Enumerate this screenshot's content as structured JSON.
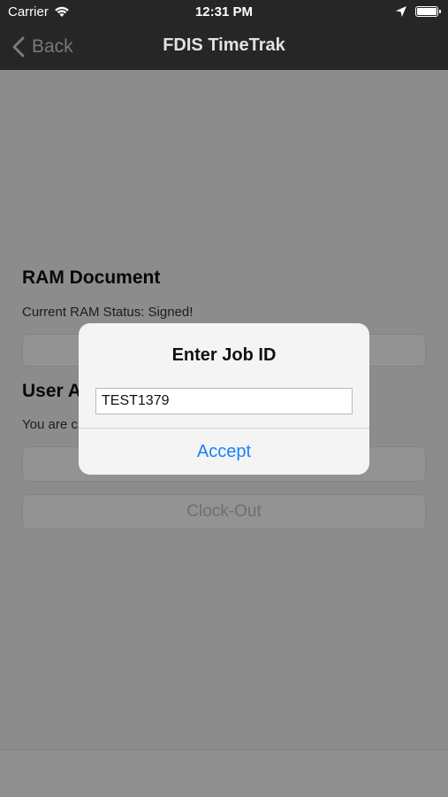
{
  "status_bar": {
    "carrier": "Carrier",
    "time": "12:31 PM"
  },
  "nav": {
    "back_label": "Back",
    "title": "FDIS TimeTrak"
  },
  "ram_section": {
    "heading": "RAM Document",
    "status_text": "Current RAM Status: Signed!"
  },
  "user_section": {
    "heading": "User A",
    "status_text": "You are c",
    "clock_out_label": "Clock-Out"
  },
  "dialog": {
    "title": "Enter Job ID",
    "input_value": "TEST1379",
    "accept_label": "Accept"
  },
  "colors": {
    "accent": "#1a82fb",
    "nav_background": "#262626",
    "overlay": "rgba(0,0,0,0.42)"
  },
  "icons": {
    "back": "chevron-left-icon",
    "wifi": "wifi-icon",
    "location": "location-arrow-icon",
    "battery": "battery-icon"
  }
}
